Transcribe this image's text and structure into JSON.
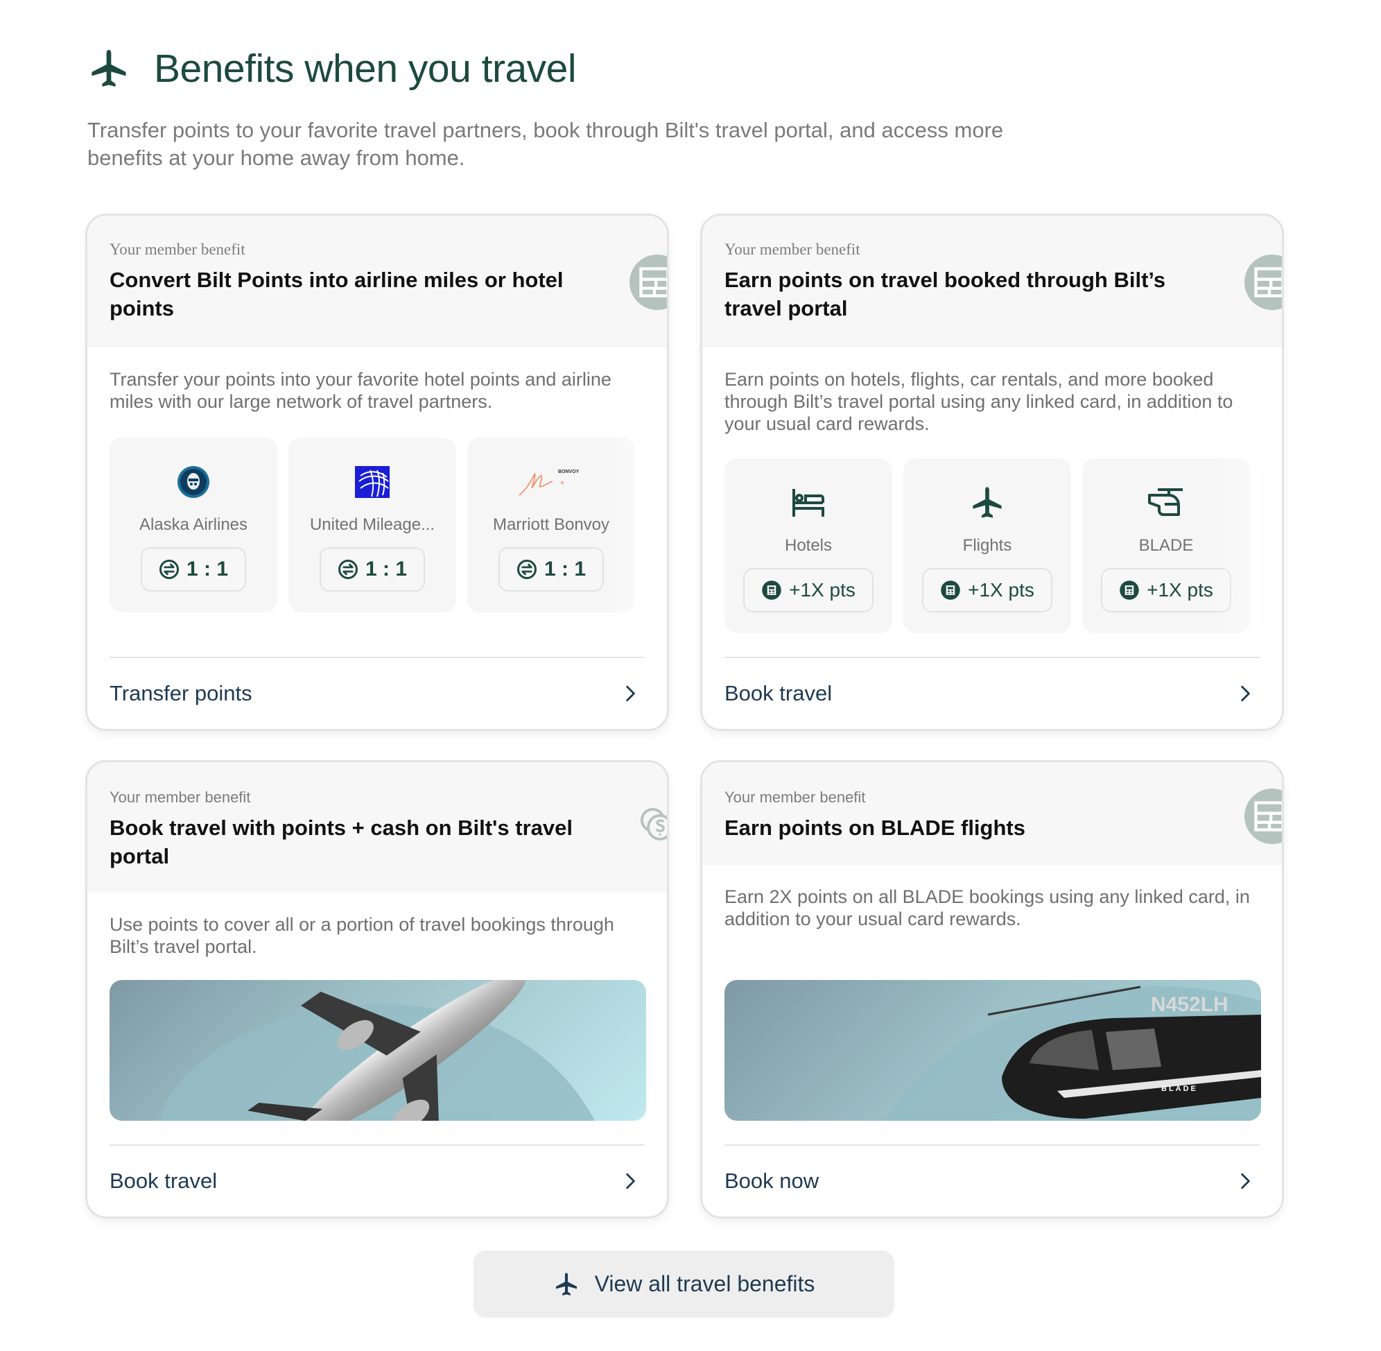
{
  "header": {
    "icon": "airplane-icon",
    "title": "Benefits when you travel",
    "subtitle": "Transfer points to your favorite travel partners, book through Bilt's travel portal, and access more benefits at your home away from home."
  },
  "colors": {
    "brand_green": "#1d4a3e",
    "link_navy": "#1e3a52",
    "badge_gray_green": "#b5c3bf",
    "card_header_bg": "#f7f7f7"
  },
  "cards": [
    {
      "eyebrow": "Your member benefit",
      "title": "Convert Bilt Points into airline miles or hotel points",
      "badge_icon": "bilt-logo-icon",
      "description": "Transfer your points into your favorite hotel points and airline miles with our large network of travel partners.",
      "tiles": [
        {
          "name": "Alaska Airlines",
          "logo": "alaska-airlines-logo",
          "ratio": "1:1"
        },
        {
          "name": "United Mileage...",
          "logo": "united-logo",
          "ratio": "1:1"
        },
        {
          "name": "Marriott Bonvoy",
          "logo": "marriott-bonvoy-logo",
          "ratio": "1:1",
          "logo_text": "MARRIOTT BONVOY"
        }
      ],
      "footer_link": "Transfer points"
    },
    {
      "eyebrow": "Your member benefit",
      "title": "Earn points on travel booked through Bilt’s travel portal",
      "badge_icon": "bilt-logo-icon",
      "description": "Earn points on hotels, flights, car rentals, and more booked through Bilt’s travel portal using any linked card, in addition to your usual card rewards.",
      "tiles": [
        {
          "name": "Hotels",
          "icon": "bed-icon",
          "points": "+1X pts"
        },
        {
          "name": "Flights",
          "icon": "airplane-icon",
          "points": "+1X pts"
        },
        {
          "name": "BLADE",
          "icon": "helicopter-icon",
          "points": "+1X pts"
        }
      ],
      "footer_link": "Book travel"
    },
    {
      "eyebrow": "Your member benefit",
      "title": "Book travel with points + cash on Bilt's travel portal",
      "badge_icon": "coins-dollar-icon",
      "description": "Use points to cover all or a portion of travel bookings through Bilt’s travel portal.",
      "image": "airplane-photo",
      "footer_link": "Book travel"
    },
    {
      "eyebrow": "Your member benefit",
      "title": "Earn points on BLADE flights",
      "badge_icon": "bilt-logo-icon",
      "description": "Earn 2X points on all BLADE bookings using any linked card, in addition to your usual card rewards.",
      "image": "blade-helicopter-photo",
      "image_text": "N452LH",
      "image_brand": "BLADE",
      "footer_link": "Book now"
    }
  ],
  "view_all": {
    "label": "View all travel benefits",
    "icon": "airplane-icon"
  }
}
